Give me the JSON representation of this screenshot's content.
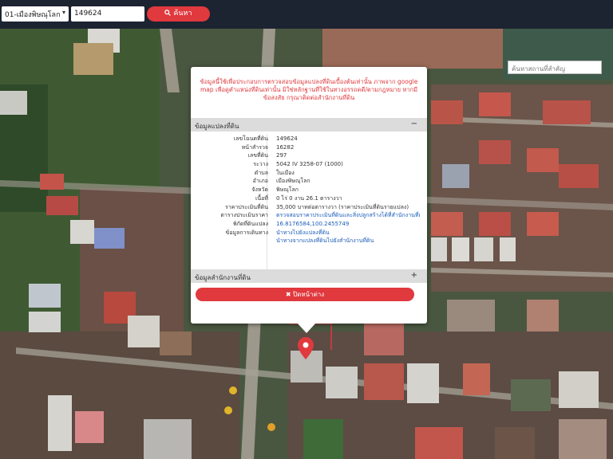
{
  "toolbar": {
    "district_value": "01-เมืองพิษณุโลก",
    "parcel_value": "149624",
    "search_icon": "search-icon",
    "search_label": "ค้นหา"
  },
  "map": {
    "search_placeholder": "ค้นหาสถานที่สำคัญ"
  },
  "popup": {
    "notice": "ข้อมูลนี้ใช้เพื่อประกอบการตรวจสอบข้อมูลแปลงที่ดินเบื้องต้นเท่านั้น ภาพจาก google map เพื่อดูตำแหน่งที่ดินเท่านั้น มิใช่หลักฐานที่ใช้ในทางอรรถคดี/ตามกฎหมาย หากมีข้อสงสัย กรุณาติดต่อสำนักงานที่ดิน",
    "section_land": "ข้อมูลแปลงที่ดิน",
    "section_land_toggle": "−",
    "rows": [
      {
        "label": "เลขโฉนดที่ดิน",
        "value": "149624"
      },
      {
        "label": "หน้าสำรวจ",
        "value": "16282"
      },
      {
        "label": "เลขที่ดิน",
        "value": "297"
      },
      {
        "label": "ระวาง",
        "value": "5042 IV 3258-07 (1000)"
      },
      {
        "label": "ตำบล",
        "value": "ในเมือง"
      },
      {
        "label": "อำเภอ",
        "value": "เมืองพิษณุโลก"
      },
      {
        "label": "จังหวัด",
        "value": "พิษณุโลก"
      },
      {
        "label": "เนื้อที่",
        "value": "0 ไร่ 0 งาน 26.1 ตารางวา"
      },
      {
        "label": "ราคาประเมินที่ดิน",
        "value": "35,000 บาทต่อตารางวา (ราคาประเมินที่ดินรายแปลง)"
      },
      {
        "label": "ตารางประเมินราคา",
        "value": "ตรวจสอบราคาประเมินที่ดินและสิ่งปลูกสร้างได้ที่สำนักงานที่ดิน"
      },
      {
        "label": "พิกัดที่ดินแปลง",
        "value": "16.8176584,100.2455749"
      },
      {
        "label": "ข้อมูลการเดินทาง",
        "value": "นำทางไปยังแปลงที่ดิน"
      },
      {
        "label": "",
        "value": "นำทางจากแปลงที่ดินไปยังสำนักงานที่ดิน"
      }
    ],
    "section_office": "ข้อมูลสำนักงานที่ดิน",
    "section_office_toggle": "+",
    "close_label": "✖ ปิดหน้าต่าง"
  }
}
